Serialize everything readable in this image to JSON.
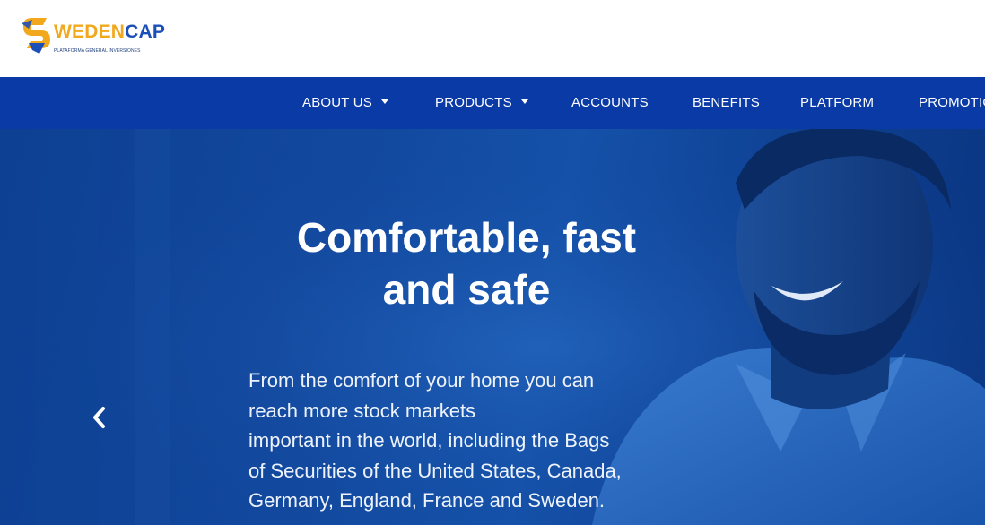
{
  "logo": {
    "text_a": "S",
    "text_b": "WEDEN",
    "text_c": "CAP",
    "tagline": "PLATAFORMA GENERAL INVERSIONES",
    "colors": {
      "orange": "#f2a81d",
      "blue": "#1d4fb8"
    }
  },
  "nav": {
    "items": [
      {
        "label": "ABOUT US",
        "has_dropdown": true
      },
      {
        "label": "PRODUCTS",
        "has_dropdown": true
      },
      {
        "label": "ACCOUNTS",
        "has_dropdown": false
      },
      {
        "label": "BENEFITS",
        "has_dropdown": false
      },
      {
        "label": "PLATFORM",
        "has_dropdown": false
      },
      {
        "label": "PROMOTIO",
        "has_dropdown": false
      }
    ],
    "background": "#0a3aa6"
  },
  "hero": {
    "title_line1": "Comfortable, fast",
    "title_line2": "and safe",
    "body_lines": [
      "From the comfort of your home you can",
      "reach more stock markets",
      "important in the world, including the Bags",
      "of Securities of the United States, Canada,",
      "Germany, England, France and Sweden."
    ],
    "prev_icon": "chevron-left-icon",
    "overlay_color": "#1552aa"
  }
}
